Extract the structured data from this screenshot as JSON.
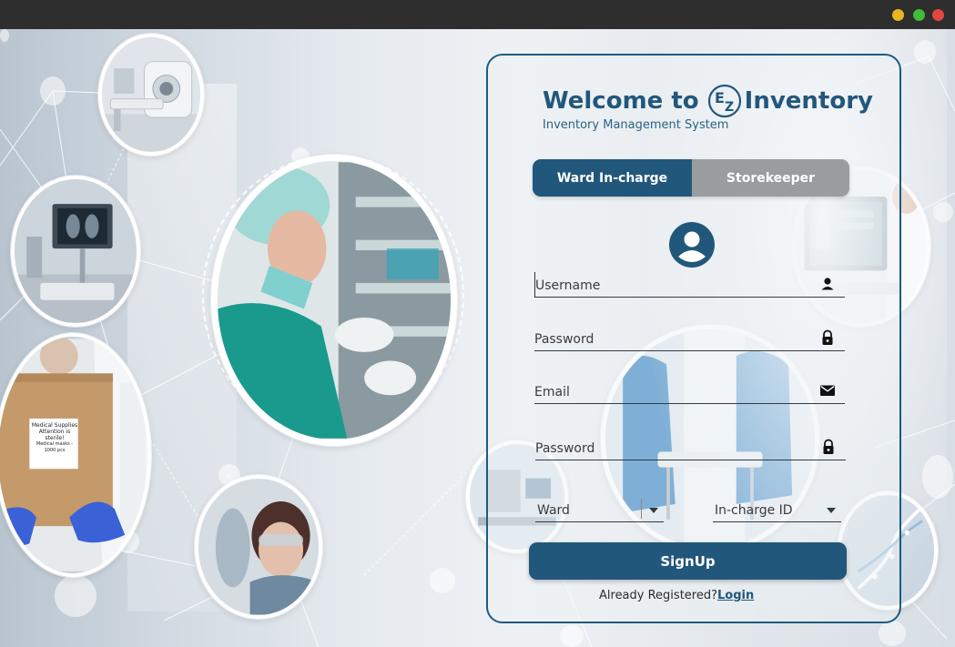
{
  "window": {
    "controls": [
      "minimize",
      "maximize",
      "close"
    ]
  },
  "header": {
    "welcome": "Welcome to",
    "logo_letters": [
      "E",
      "Z"
    ],
    "brand": "Inventory",
    "subtitle": "Inventory Management System"
  },
  "tabs": [
    {
      "label": "Ward In-charge",
      "active": true
    },
    {
      "label": "Storekeeper",
      "active": false
    }
  ],
  "form": {
    "username_placeholder": "Username",
    "password_placeholder": "Password",
    "email_placeholder": "Email",
    "confirm_password_placeholder": "Password",
    "ward_label": "Ward",
    "incharge_label": "In-charge ID",
    "signup_label": "SignUp"
  },
  "footer": {
    "already_text": "Already Registered?",
    "login_label": "Login"
  },
  "box_label": [
    "Medical Supplies",
    "Attention is sterile!",
    "Medical masks - 1000 pcs"
  ],
  "colors": {
    "primary": "#22577c",
    "inactive_tab": "#9a9da0",
    "card_border": "#1f5a7e"
  }
}
